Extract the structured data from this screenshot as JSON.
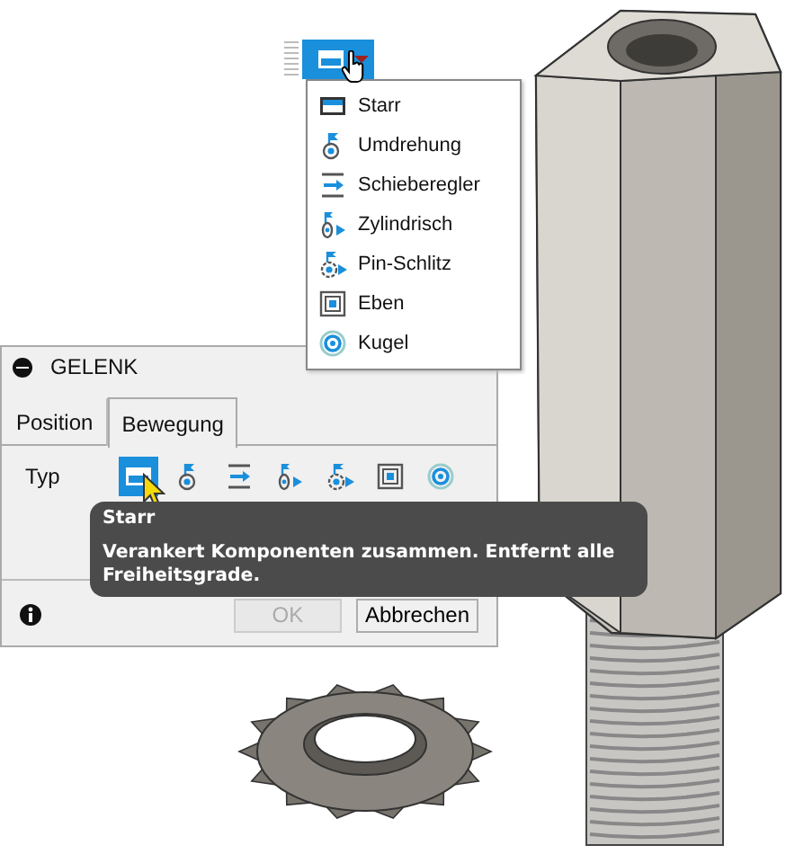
{
  "joint_menu": {
    "button": {
      "kind": "rigid"
    },
    "items": [
      {
        "label": "Starr",
        "kind": "rigid"
      },
      {
        "label": "Umdrehung",
        "kind": "revolute"
      },
      {
        "label": "Schieberegler",
        "kind": "slider"
      },
      {
        "label": "Zylindrisch",
        "kind": "cylindrical"
      },
      {
        "label": "Pin-Schlitz",
        "kind": "pin_slot"
      },
      {
        "label": "Eben",
        "kind": "planar"
      },
      {
        "label": "Kugel",
        "kind": "ball"
      }
    ]
  },
  "dialog": {
    "title": "GELENK",
    "tabs": [
      {
        "label": "Position",
        "selected": false
      },
      {
        "label": "Bewegung",
        "selected": true
      }
    ],
    "type_label": "Typ",
    "types": [
      {
        "kind": "rigid",
        "selected": true
      },
      {
        "kind": "revolute",
        "selected": false
      },
      {
        "kind": "slider",
        "selected": false
      },
      {
        "kind": "cylindrical",
        "selected": false
      },
      {
        "kind": "pin_slot",
        "selected": false
      },
      {
        "kind": "planar",
        "selected": false
      },
      {
        "kind": "ball",
        "selected": false
      }
    ],
    "tooltip": {
      "title": "Starr",
      "text": "Verankert Komponenten zusammen. Entfernt alle Freiheitsgrade."
    },
    "buttons": [
      {
        "label": "OK",
        "disabled": true
      },
      {
        "label": "Abbrechen",
        "disabled": false
      }
    ]
  }
}
